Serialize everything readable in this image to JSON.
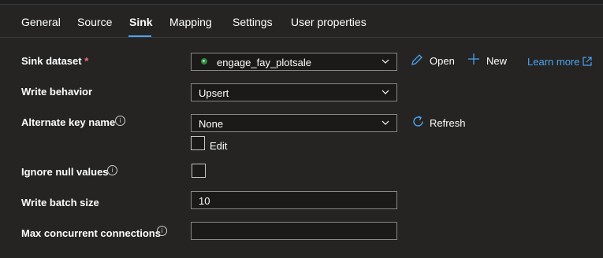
{
  "tabs": [
    {
      "label": "General"
    },
    {
      "label": "Source"
    },
    {
      "label": "Sink"
    },
    {
      "label": "Mapping"
    },
    {
      "label": "Settings"
    },
    {
      "label": "User properties"
    }
  ],
  "active_tab": "Sink",
  "sink_dataset": {
    "label": "Sink dataset",
    "required_mark": "*",
    "value": "engage_fay_plotsale",
    "open_label": "Open",
    "new_label": "New",
    "learn_more_label": "Learn more"
  },
  "write_behavior": {
    "label": "Write behavior",
    "value": "Upsert"
  },
  "alternate_key": {
    "label": "Alternate key name",
    "value": "None",
    "refresh_label": "Refresh",
    "edit_label": "Edit",
    "edit_checked": false
  },
  "ignore_null": {
    "label": "Ignore null values",
    "checked": false
  },
  "write_batch_size": {
    "label": "Write batch size",
    "value": "10"
  },
  "max_concurrent": {
    "label": "Max concurrent connections",
    "value": ""
  },
  "colors": {
    "background": "#252423",
    "accent": "#4ba3f0",
    "required": "#f1707b",
    "field_border": "#8a8886"
  }
}
